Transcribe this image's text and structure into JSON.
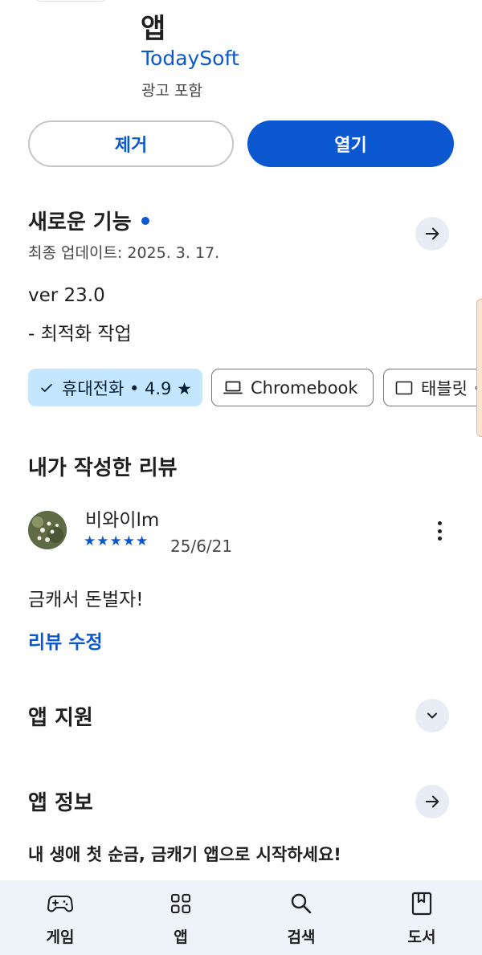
{
  "header": {
    "app_title": "앱",
    "developer": "TodaySoft",
    "ads_note": "광고 포함"
  },
  "actions": {
    "remove_label": "제거",
    "open_label": "열기"
  },
  "whats_new": {
    "title": "새로운 기능",
    "last_updated": "최종 업데이트: 2025. 3. 17.",
    "version": "ver 23.0",
    "notes": "- 최적화 작업"
  },
  "devices": [
    {
      "label": "휴대전화 • 4.9 ★",
      "icon": "check-icon",
      "selected": true
    },
    {
      "label": "Chromebook",
      "icon": "laptop-icon",
      "selected": false
    },
    {
      "label": "태블릿 •",
      "icon": "tablet-icon",
      "selected": false
    }
  ],
  "my_review": {
    "title": "내가 작성한 리뷰",
    "reviewer": "비와이lm",
    "rating": 5,
    "stars": "★★★★★",
    "date": "25/6/21",
    "text": "금캐서 돈벌자!",
    "edit_label": "리뷰 수정"
  },
  "app_support": {
    "title": "앱 지원"
  },
  "app_info": {
    "title": "앱 정보",
    "description": "내 생애 첫 순금, 금캐기 앱으로 시작하세요!"
  },
  "bottom_nav": [
    {
      "label": "게임",
      "icon": "gamepad-icon"
    },
    {
      "label": "앱",
      "icon": "apps-grid-icon"
    },
    {
      "label": "검색",
      "icon": "search-icon"
    },
    {
      "label": "도서",
      "icon": "book-icon"
    }
  ],
  "colors": {
    "accent": "#0b57d0",
    "chip_selected_bg": "#c2e7ff",
    "nav_bg": "#eef2f9",
    "circle_btn_bg": "#e7ecf5"
  }
}
